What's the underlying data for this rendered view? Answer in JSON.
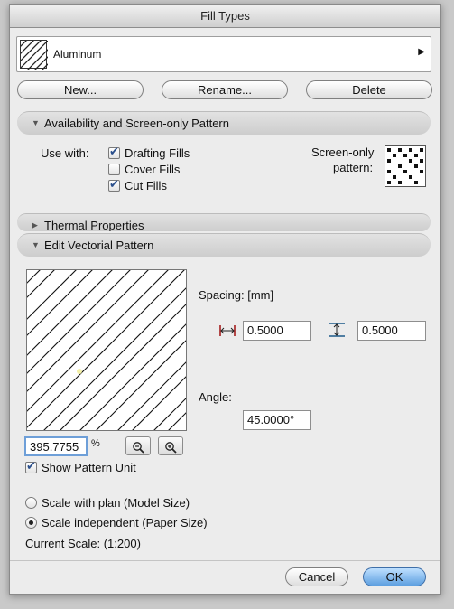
{
  "window": {
    "title": "Fill Types"
  },
  "selector": {
    "name": "Aluminum"
  },
  "buttons": {
    "new": "New...",
    "rename": "Rename...",
    "delete": "Delete",
    "cancel": "Cancel",
    "ok": "OK"
  },
  "sections": {
    "availability": "Availability and Screen-only Pattern",
    "thermal": "Thermal Properties",
    "vectorial": "Edit Vectorial Pattern"
  },
  "availability": {
    "use_with_label": "Use with:",
    "options": [
      {
        "label": "Drafting Fills",
        "checked": true
      },
      {
        "label": "Cover Fills",
        "checked": false
      },
      {
        "label": "Cut Fills",
        "checked": true
      }
    ],
    "screen_only_label_1": "Screen-only",
    "screen_only_label_2": "pattern:"
  },
  "vectorial": {
    "spacing_label": "Spacing: [mm]",
    "spacing_x": "0.5000",
    "spacing_y": "0.5000",
    "angle_label": "Angle:",
    "angle": "45.0000°",
    "zoom_value": "395.7755",
    "zoom_unit": "%",
    "show_pattern_unit": {
      "label": "Show Pattern Unit",
      "checked": true
    },
    "scale_options": [
      {
        "label": "Scale with plan (Model Size)",
        "selected": false
      },
      {
        "label": "Scale independent (Paper Size)",
        "selected": true
      }
    ],
    "current_scale": "Current Scale: (1:200)"
  },
  "icons": {
    "zoom_out": "zoom-out-icon",
    "zoom_in": "zoom-in-icon",
    "horizontal_spacing": "horizontal-spacing-icon",
    "vertical_spacing": "vertical-spacing-icon",
    "disclosure_open": "triangle-down-icon",
    "disclosure_closed": "triangle-right-icon"
  },
  "colors": {
    "ok_button": "#7fb6ea",
    "checkmark": "#2a4f8c"
  }
}
